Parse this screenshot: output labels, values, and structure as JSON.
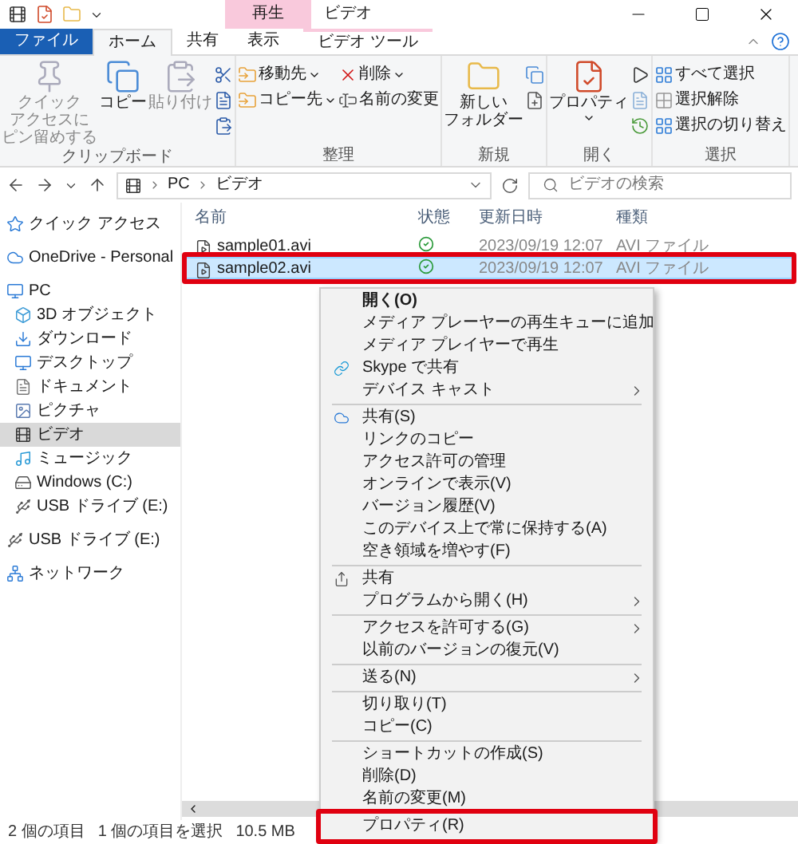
{
  "window": {
    "title": "ビデオ",
    "context_tab": "再生"
  },
  "ribbon_tabs": [
    {
      "label": "ファイル",
      "kind": "file",
      "selected": false
    },
    {
      "label": "ホーム",
      "kind": "normal",
      "selected": true
    },
    {
      "label": "共有",
      "kind": "normal",
      "selected": false
    },
    {
      "label": "表示",
      "kind": "normal",
      "selected": false
    },
    {
      "label": "ビデオ ツール",
      "kind": "context",
      "selected": false
    }
  ],
  "ribbon": [
    {
      "name": "クリップボード",
      "items": [
        {
          "kind": "large",
          "lines": [
            "クイック",
            "アクセスに",
            "ピン留めする"
          ],
          "disabled": true,
          "has_menu": false
        },
        {
          "kind": "large",
          "lines": [
            "コピー"
          ],
          "disabled": false,
          "has_menu": false
        },
        {
          "kind": "large",
          "lines": [
            "貼り付け"
          ],
          "disabled": true,
          "has_menu": false
        },
        {
          "kind": "icons"
        }
      ]
    },
    {
      "name": "整理",
      "items": [
        {
          "kind": "small",
          "label": "移動先",
          "has_menu": true
        },
        {
          "kind": "small",
          "label": "コピー先",
          "has_menu": true
        },
        {
          "kind": "small",
          "label": "削除",
          "has_menu": true
        },
        {
          "kind": "small",
          "label": "名前の変更",
          "has_menu": false
        }
      ]
    },
    {
      "name": "新規",
      "items": [
        {
          "kind": "large",
          "lines": [
            "新しい",
            "フォルダー"
          ],
          "disabled": false,
          "has_menu": false
        },
        {
          "kind": "icons"
        }
      ]
    },
    {
      "name": "開く",
      "items": [
        {
          "kind": "large",
          "lines": [
            "プロパティ"
          ],
          "disabled": false,
          "has_menu": true
        },
        {
          "kind": "icons"
        }
      ]
    },
    {
      "name": "選択",
      "items": [
        {
          "kind": "small",
          "label": "すべて選択"
        },
        {
          "kind": "small",
          "label": "選択解除"
        },
        {
          "kind": "small",
          "label": "選択の切り替え"
        }
      ]
    }
  ],
  "address": {
    "path": [
      "PC",
      "ビデオ"
    ],
    "search": {
      "placeholder": "ビデオの検索"
    }
  },
  "sidebar": {
    "items": [
      {
        "label": "クイック アクセス",
        "selected": false
      },
      {
        "label": "OneDrive - Personal",
        "selected": false
      },
      {
        "label": "PC",
        "selected": false,
        "children": [
          {
            "label": "3D オブジェクト",
            "selected": false
          },
          {
            "label": "ダウンロード",
            "selected": false
          },
          {
            "label": "デスクトップ",
            "selected": false
          },
          {
            "label": "ドキュメント",
            "selected": false
          },
          {
            "label": "ピクチャ",
            "selected": false
          },
          {
            "label": "ビデオ",
            "selected": true
          },
          {
            "label": "ミュージック",
            "selected": false
          },
          {
            "label": "Windows (C:)",
            "selected": false
          },
          {
            "label": "USB ドライブ (E:)",
            "selected": false
          }
        ]
      },
      {
        "label": "USB ドライブ (E:)",
        "selected": false
      },
      {
        "label": "ネットワーク",
        "selected": false
      }
    ]
  },
  "table": {
    "columns": [
      "名前",
      "状態",
      "更新日時",
      "種類"
    ],
    "rows": [
      {
        "name": "sample01.avi",
        "synced": true,
        "date": "2023/09/19 12:07",
        "type": "AVI ファイル",
        "selected": false,
        "highlighted": false
      },
      {
        "name": "sample02.avi",
        "synced": true,
        "date": "2023/09/19 12:07",
        "type": "AVI ファイル",
        "selected": true,
        "highlighted": true
      }
    ]
  },
  "context_menu": {
    "groups": [
      [
        {
          "label": "開く(O)",
          "bold": true,
          "submenu": false,
          "highlighted": false
        },
        {
          "label": "メディア プレーヤーの再生キューに追加",
          "bold": false,
          "submenu": false,
          "highlighted": false
        },
        {
          "label": "メディア プレイヤーで再生",
          "bold": false,
          "submenu": false,
          "highlighted": false
        },
        {
          "label": "Skype で共有",
          "bold": false,
          "submenu": false,
          "highlighted": false
        },
        {
          "label": "デバイス キャスト",
          "bold": false,
          "submenu": true,
          "highlighted": false
        }
      ],
      [
        {
          "label": "共有(S)",
          "bold": false,
          "submenu": false,
          "highlighted": false
        },
        {
          "label": "リンクのコピー",
          "bold": false,
          "submenu": false,
          "highlighted": false
        },
        {
          "label": "アクセス許可の管理",
          "bold": false,
          "submenu": false,
          "highlighted": false
        },
        {
          "label": "オンラインで表示(V)",
          "bold": false,
          "submenu": false,
          "highlighted": false
        },
        {
          "label": "バージョン履歴(V)",
          "bold": false,
          "submenu": false,
          "highlighted": false
        },
        {
          "label": "このデバイス上で常に保持する(A)",
          "bold": false,
          "submenu": false,
          "highlighted": false
        },
        {
          "label": "空き領域を増やす(F)",
          "bold": false,
          "submenu": false,
          "highlighted": false
        }
      ],
      [
        {
          "label": "共有",
          "bold": false,
          "submenu": false,
          "highlighted": false
        },
        {
          "label": "プログラムから開く(H)",
          "bold": false,
          "submenu": true,
          "highlighted": false
        }
      ],
      [
        {
          "label": "アクセスを許可する(G)",
          "bold": false,
          "submenu": true,
          "highlighted": false
        },
        {
          "label": "以前のバージョンの復元(V)",
          "bold": false,
          "submenu": false,
          "highlighted": false
        }
      ],
      [
        {
          "label": "送る(N)",
          "bold": false,
          "submenu": true,
          "highlighted": false
        }
      ],
      [
        {
          "label": "切り取り(T)",
          "bold": false,
          "submenu": false,
          "highlighted": false
        },
        {
          "label": "コピー(C)",
          "bold": false,
          "submenu": false,
          "highlighted": false
        }
      ],
      [
        {
          "label": "ショートカットの作成(S)",
          "bold": false,
          "submenu": false,
          "highlighted": false
        },
        {
          "label": "削除(D)",
          "bold": false,
          "submenu": false,
          "highlighted": false
        },
        {
          "label": "名前の変更(M)",
          "bold": false,
          "submenu": false,
          "highlighted": false
        }
      ],
      [
        {
          "label": "プロパティ(R)",
          "bold": false,
          "submenu": false,
          "highlighted": true
        }
      ]
    ]
  },
  "status_bar": [
    "2 個の項目",
    "1 個の項目を選択",
    "10.5 MB"
  ]
}
